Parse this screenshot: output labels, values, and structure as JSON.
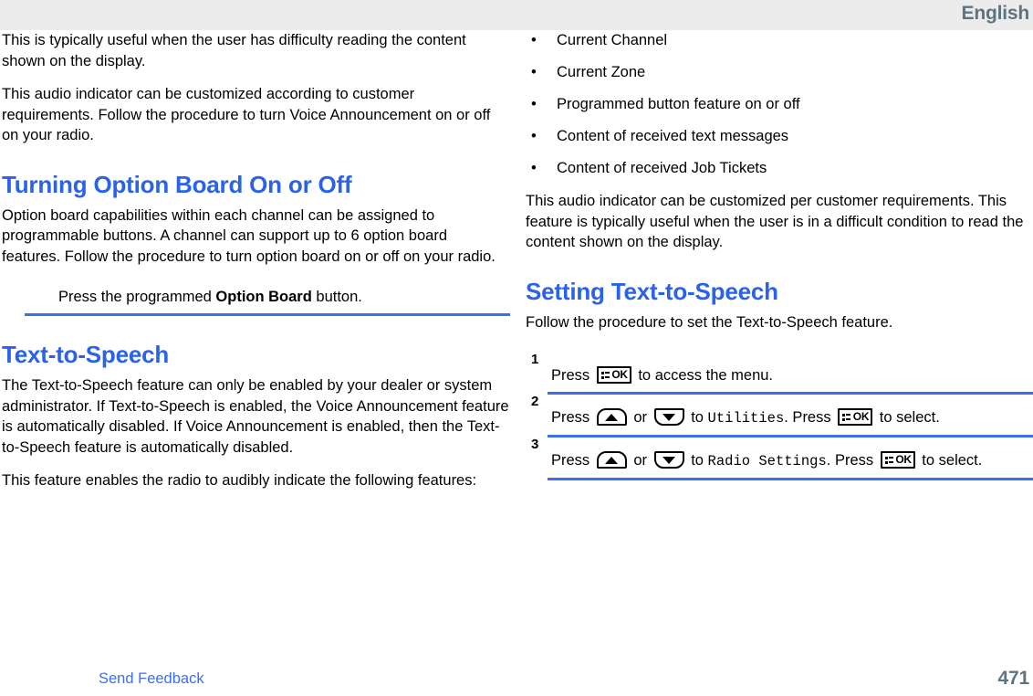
{
  "header": {
    "language": "English"
  },
  "left_column": {
    "paragraphs": [
      "This is typically useful when the user has difficulty reading the content shown on the display.",
      "This audio indicator can be customized according to customer requirements. Follow the procedure to turn Voice Announcement on or off on your radio."
    ],
    "heading_option_board": "Turning Option Board On or Off",
    "option_board_paragraph": "Option board capabilities within each channel can be assigned to programmable buttons. A channel can support up to 6 option board features. Follow the procedure to turn option board on or off on your radio.",
    "option_board_step": {
      "prefix": "Press the programmed ",
      "bold": "Option Board",
      "suffix": " button."
    },
    "heading_text_to_speech": "Text-to-Speech",
    "tts_paragraphs": [
      "The Text-to-Speech feature can only be enabled by your dealer or system administrator. If Text-to-Speech is enabled, the Voice Announcement feature is automatically disabled. If Voice Announcement is enabled, then the Text-to-Speech feature is automatically disabled.",
      "This feature enables the radio to audibly indicate the following features:"
    ]
  },
  "right_column": {
    "bullets": [
      "Current Channel",
      "Current Zone",
      "Programmed button feature on or off",
      "Content of received text messages",
      "Content of received Job Tickets"
    ],
    "bullet_char": "•",
    "paragraph": "This audio indicator can be customized per customer requirements. This feature is typically useful when the user is in a difficult condition to read the content shown on the display.",
    "heading_setting_tts": "Setting Text-to-Speech",
    "intro": "Follow the procedure to set the Text-to-Speech feature.",
    "steps": [
      {
        "number": "1",
        "part1": "Press ",
        "key1": "ok-key",
        "part2": " to access the menu."
      },
      {
        "number": "2",
        "part1": "Press ",
        "key1": "up-arrow-key",
        "part2": " or ",
        "key2": "down-arrow-key",
        "part3": " to ",
        "menu": "Utilities",
        "part4": ". Press ",
        "key3": "ok-key",
        "part5": " to select."
      },
      {
        "number": "3",
        "part1": "Press ",
        "key1": "up-arrow-key",
        "part2": " or ",
        "key2": "down-arrow-key",
        "part3": " to ",
        "menu": "Radio Settings",
        "part4": ". Press ",
        "key3": "ok-key",
        "part5": " to select."
      }
    ],
    "key_labels": {
      "ok": "OK"
    }
  },
  "footer": {
    "send_feedback": "Send Feedback",
    "page_number": "471"
  },
  "colors": {
    "heading_blue": "#2a62e8",
    "rule_blue": "#3b6ff0",
    "link_blue": "#3b6ff0",
    "header_gray_text": "#5f7480",
    "header_band": "#ececec"
  }
}
